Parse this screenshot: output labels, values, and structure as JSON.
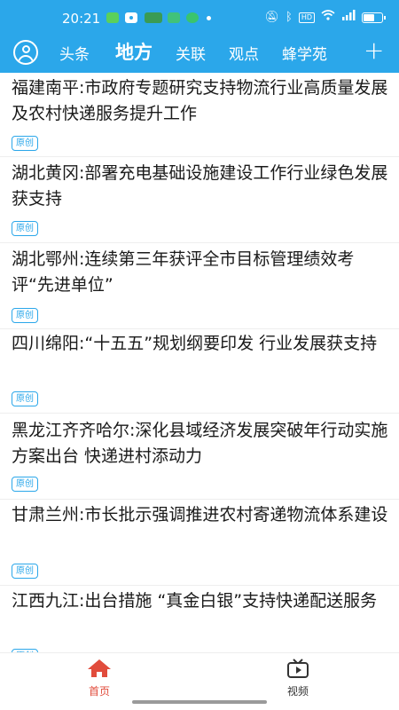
{
  "status_bar": {
    "time": "20:21",
    "hd_label": "HD",
    "signal_label": "5G"
  },
  "tabs": [
    {
      "label": "头条",
      "active": false
    },
    {
      "label": "地方",
      "active": true
    },
    {
      "label": "关联",
      "active": false
    },
    {
      "label": "观点",
      "active": false
    },
    {
      "label": "蜂学苑",
      "active": false
    }
  ],
  "add_tab_label": "+",
  "news": [
    {
      "title": "福建南平:市政府专题研究支持物流行业高质量发展及农村快递服务提升工作",
      "badge": "原创"
    },
    {
      "title": "湖北黄冈:部署充电基础设施建设工作行业绿色发展获支持",
      "badge": "原创"
    },
    {
      "title": "湖北鄂州:连续第三年获评全市目标管理绩效考评“先进单位”",
      "badge": "原创"
    },
    {
      "title": "四川绵阳:“十五五”规划纲要印发 行业发展获支持",
      "badge": "原创"
    },
    {
      "title": "黑龙江齐齐哈尔:深化县域经济发展突破年行动实施方案出台 快递进村添动力",
      "badge": "原创"
    },
    {
      "title": "甘肃兰州:市长批示强调推进农村寄递物流体系建设",
      "badge": "原创"
    },
    {
      "title": "江西九江:出台措施 “真金白银”支持快递配送服务",
      "badge": "原创"
    }
  ],
  "bottom_nav": {
    "home_label": "首页",
    "video_label": "视频"
  },
  "colors": {
    "header": "#2ba7ea",
    "badge": "#2ba7ea",
    "home_active": "#e14c3c"
  }
}
